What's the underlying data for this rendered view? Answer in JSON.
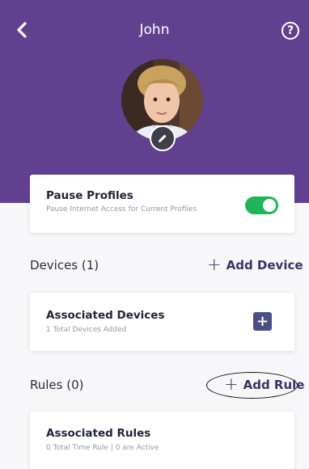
{
  "header": {
    "title": "John",
    "background_color": "#61418f",
    "back_icon": "chevron-left-icon",
    "help_label": "?"
  },
  "avatar": {
    "edit_icon": "pencil-icon"
  },
  "pause_card": {
    "title": "Pause Profiles",
    "subtitle": "Pause Internet Access for Current Profiles",
    "toggle_on": true,
    "toggle_color": "#20b45a"
  },
  "devices_section": {
    "title": "Devices (1)",
    "action_plus": "+",
    "action_label": "Add Device",
    "card": {
      "title": "Associated Devices",
      "subtitle": "1 Total Devices Added",
      "add_button_label": "+"
    }
  },
  "rules_section": {
    "title": "Rules (0)",
    "action_plus": "+",
    "action_label": "Add Rule",
    "card": {
      "title": "Associated Rules",
      "subtitle": "0 Total Time Rule | 0 are Active"
    }
  }
}
